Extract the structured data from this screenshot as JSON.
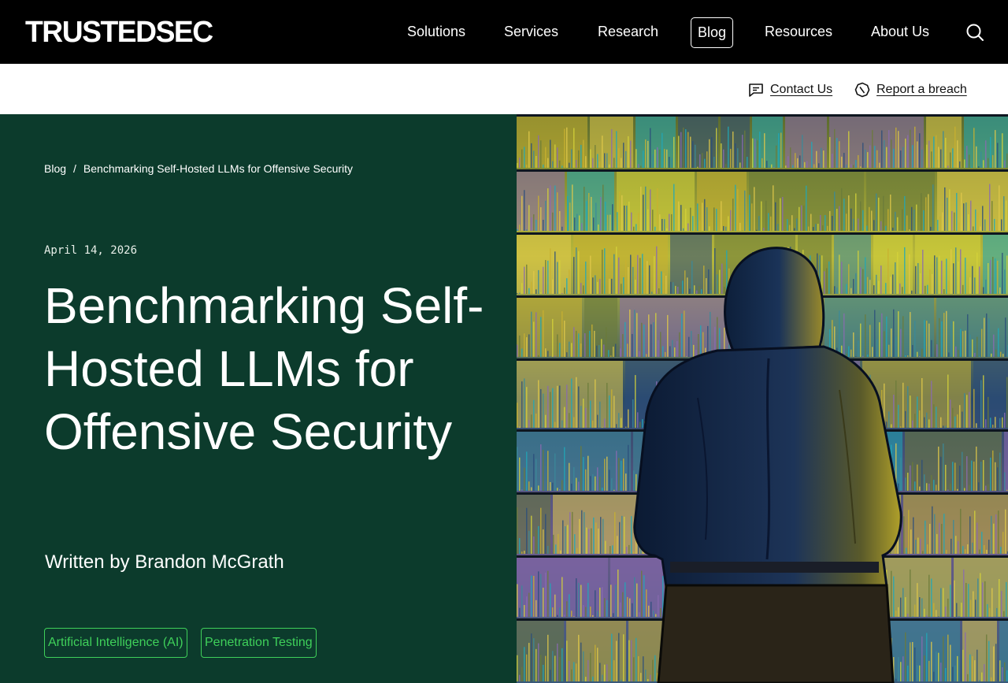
{
  "nav": {
    "logo": "TRUSTEDSEC",
    "items": [
      {
        "label": "Solutions"
      },
      {
        "label": "Services"
      },
      {
        "label": "Research"
      },
      {
        "label": "Blog"
      },
      {
        "label": "Resources"
      },
      {
        "label": "About Us"
      }
    ],
    "active": "Blog",
    "search_icon": "search-icon"
  },
  "utility": {
    "contact_label": "Contact Us",
    "contact_icon": "message-icon",
    "breach_label": "Report a breach",
    "breach_icon": "alert-octagon-icon"
  },
  "breadcrumb": {
    "root": "Blog",
    "separator": "/",
    "current": "Benchmarking Self-Hosted LLMs for Offensive Security"
  },
  "post": {
    "date": "April 14, 2026",
    "title": "Benchmarking Self-Hosted LLMs for Offensive Security",
    "author": "Written by Brandon McGrath",
    "tags": [
      "Artificial Intelligence (AI)",
      "Penetration Testing"
    ]
  },
  "colors": {
    "nav_bg": "#000000",
    "hero_bg": "#0c3b2c",
    "tag_accent": "#3fd05a"
  }
}
